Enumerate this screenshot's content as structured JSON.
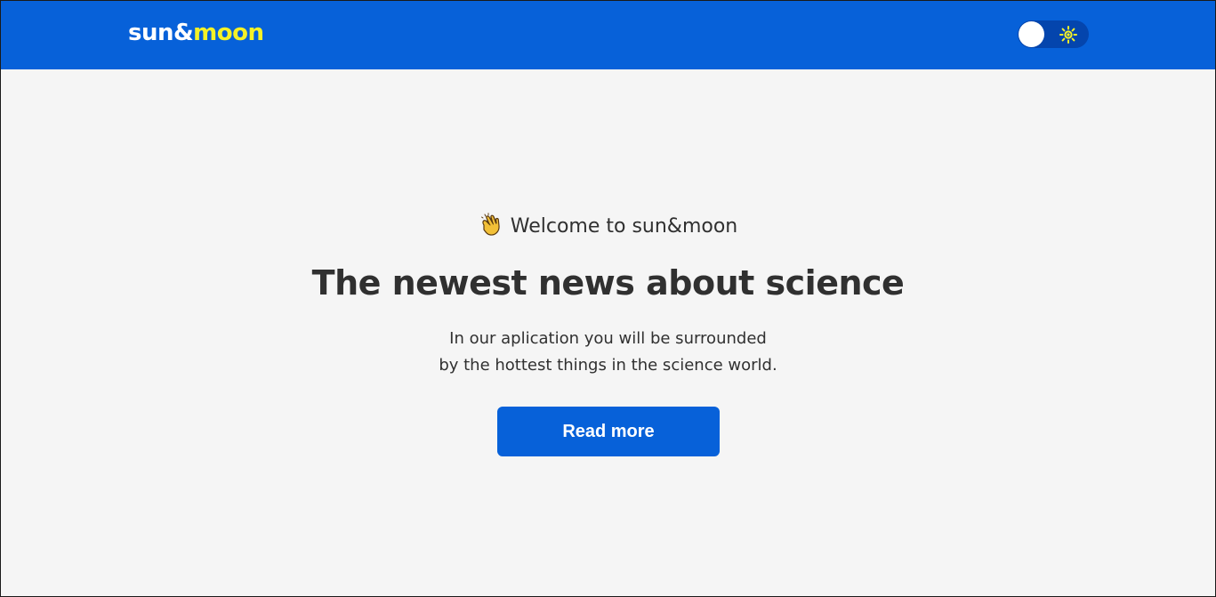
{
  "header": {
    "logo_part_a": "sun&",
    "logo_part_b": "moon",
    "theme_toggle": {
      "state": "light",
      "icon": "sun-icon"
    }
  },
  "hero": {
    "welcome_icon": "clapping-hands-icon",
    "welcome_text": "Welcome to sun&moon",
    "headline": "The newest news about science",
    "subtext_line_1": "In our aplication you will be surrounded",
    "subtext_line_2": "by the hottest things in the science world.",
    "cta_label": "Read more"
  },
  "colors": {
    "header_bg": "#0761d9",
    "logo_accent": "#f5f227",
    "page_bg": "#f5f5f5",
    "text": "#303030",
    "button_bg": "#0761d9"
  }
}
